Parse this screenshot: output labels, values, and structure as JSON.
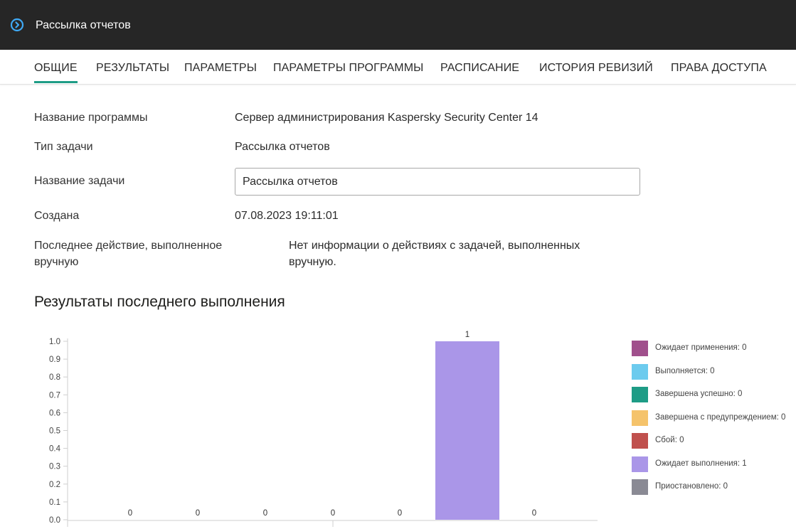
{
  "window": {
    "title": "Рассылка отчетов",
    "icon": "chevron-right-circle-icon"
  },
  "tabs": [
    {
      "label": "ОБЩИЕ",
      "active": true
    },
    {
      "label": "РЕЗУЛЬТАТЫ",
      "active": false
    },
    {
      "label": "ПАРАМЕТРЫ",
      "active": false
    },
    {
      "label": "ПАРАМЕТРЫ ПРОГРАММЫ",
      "active": false
    },
    {
      "label": "РАСПИСАНИЕ",
      "active": false
    },
    {
      "label": "ИСТОРИЯ РЕВИЗИЙ",
      "active": false
    },
    {
      "label": "ПРАВА ДОСТУПА",
      "active": false
    }
  ],
  "general": {
    "app_name_label": "Название программы",
    "app_name_value": "Сервер администрирования Kaspersky Security Center 14",
    "task_type_label": "Тип задачи",
    "task_type_value": "Рассылка отчетов",
    "task_name_label": "Название задачи",
    "task_name_value": "Рассылка отчетов",
    "created_label": "Создана",
    "created_value": "07.08.2023 19:11:01",
    "last_action_label_1": "Последнее действие, выполненное",
    "last_action_label_2": "вручную",
    "last_action_value_1": "Нет информации о действиях с задачей, выполненных",
    "last_action_value_2": "вручную."
  },
  "results_title": "Результаты последнего выполнения",
  "colors": {
    "accent": "#1e9c86",
    "titlebar": "#262626",
    "icon": "#3fa9f5"
  },
  "chart_data": {
    "type": "bar",
    "categories": [
      "Ожидает применения",
      "Выполняется",
      "Завершена успешно",
      "Завершена с предупреждением",
      "Сбой",
      "Ожидает выполнения",
      "Приостановлено"
    ],
    "values": [
      0,
      0,
      0,
      0,
      0,
      1,
      0
    ],
    "colors": [
      "#a0508c",
      "#6ccbee",
      "#1e9c86",
      "#f5c36b",
      "#c0504d",
      "#aa96e8",
      "#8a8a94"
    ],
    "y_ticks": [
      "0.0",
      "0.1",
      "0.2",
      "0.3",
      "0.4",
      "0.5",
      "0.6",
      "0.7",
      "0.8",
      "0.9",
      "1.0"
    ],
    "ylim": [
      0,
      1
    ],
    "legend": [
      "Ожидает применения: 0",
      "Выполняется: 0",
      "Завершена успешно: 0",
      "Завершена с предупреждением: 0",
      "Сбой: 0",
      "Ожидает выполнения: 1",
      "Приостановлено: 0"
    ],
    "legend_position": "right",
    "grid": false
  }
}
